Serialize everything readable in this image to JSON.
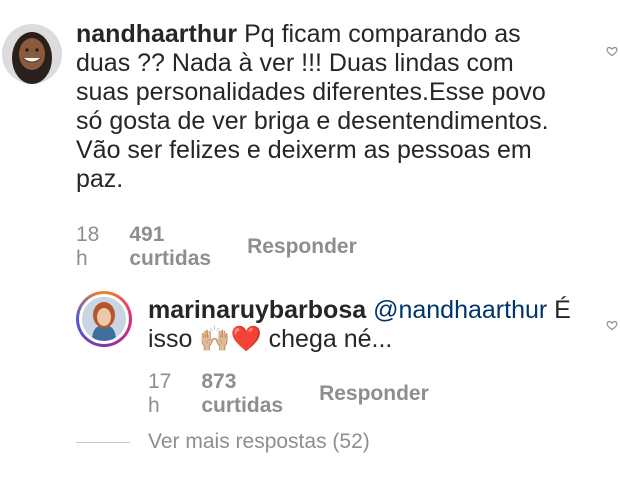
{
  "comment": {
    "username": "nandhaarthur",
    "text": "Pq ficam comparando as duas ?? Nada à ver !!! Duas lindas com suas personalidades diferentes.Esse povo só gosta de ver briga e desentendimentos. Vão ser felizes e deixerm as pessoas em paz.",
    "time": "18 h",
    "likes": "491 curtidas",
    "reply_label": "Responder"
  },
  "reply": {
    "username": "marinaruybarbosa",
    "mention": "@nandhaarthur",
    "text_before_emoji": "É isso",
    "emoji": "🙌🏼❤️",
    "text_after_emoji": "chega né...",
    "time": "17 h",
    "likes": "873 curtidas",
    "reply_label": "Responder"
  },
  "view_more_label": "Ver mais respostas (52)",
  "icons": {
    "like": "heart-outline-icon"
  }
}
